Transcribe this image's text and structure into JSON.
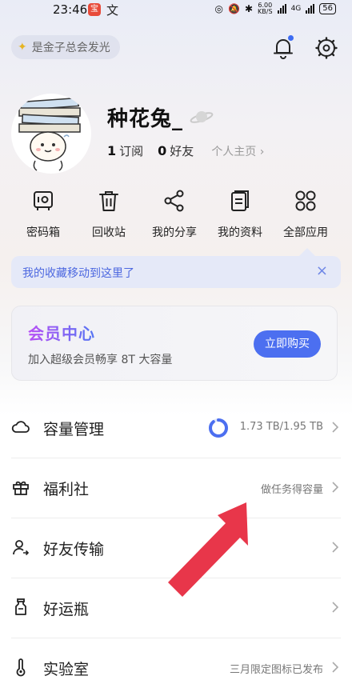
{
  "status_bar": {
    "time": "23:46",
    "app_icon_1": "宝",
    "app_icon_2": "文",
    "net_speed": "6.00",
    "net_unit": "KB/S",
    "signal_label": "4G",
    "battery": "56"
  },
  "top": {
    "tip": "是金子总会发光",
    "bell_icon": "bell-icon",
    "settings_icon": "gear-icon"
  },
  "profile": {
    "username": "种花兔_",
    "subscriptions_count": "1",
    "subscriptions_label": "订阅",
    "friends_count": "0",
    "friends_label": "好友",
    "homepage_label": "个人主页 ›"
  },
  "quick_actions": [
    {
      "label": "密码箱",
      "icon": "safe-icon"
    },
    {
      "label": "回收站",
      "icon": "trash-icon"
    },
    {
      "label": "我的分享",
      "icon": "share-icon"
    },
    {
      "label": "我的资料",
      "icon": "documents-icon"
    },
    {
      "label": "全部应用",
      "icon": "apps-grid-icon"
    }
  ],
  "notice": {
    "text": "我的收藏移动到这里了",
    "close": "×"
  },
  "vip": {
    "title": "会员中心",
    "subtitle": "加入超级会员畅享 8T 大容量",
    "button": "立即购买"
  },
  "menu": [
    {
      "label": "容量管理",
      "right": "1.73 TB/1.95 TB",
      "icon": "cloud-icon",
      "used_fraction": 0.887
    },
    {
      "label": "福利社",
      "right": "做任务得容量",
      "icon": "gift-icon"
    },
    {
      "label": "好友传输",
      "right": "",
      "icon": "friend-transfer-icon"
    },
    {
      "label": "好运瓶",
      "right": "",
      "icon": "bottle-icon"
    },
    {
      "label": "实验室",
      "right": "三月限定图标已发布",
      "icon": "thermometer-icon"
    }
  ],
  "colors": {
    "accent": "#4c6ff0",
    "notice_text": "#4d68e0",
    "annotation_arrow": "#e8364a"
  }
}
